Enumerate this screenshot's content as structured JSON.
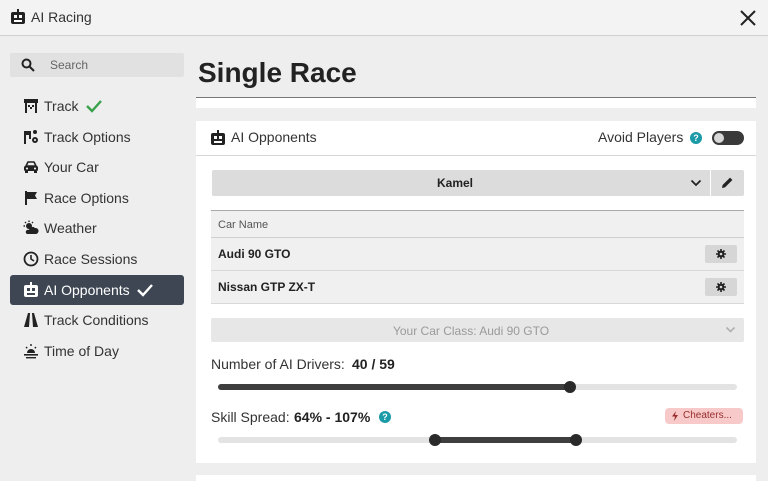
{
  "window": {
    "title": "AI Racing"
  },
  "icons": {
    "app": "robot-icon",
    "close": "close-icon",
    "search": "search-icon",
    "track": "track-flag-icon",
    "track_options": "track-settings-icon",
    "your_car": "car-icon",
    "race_options": "flag-icon",
    "weather": "weather-icon",
    "race_sessions": "clock-icon",
    "ai_opponents": "robot-icon",
    "track_conditions": "road-icon",
    "time_of_day": "sunrise-icon",
    "check": "checkmark-icon",
    "help": "help-icon",
    "edit": "pencil-icon",
    "settings": "gear-icon",
    "cheaters": "lightning-icon"
  },
  "colors": {
    "active_nav": "#3d4652",
    "check_green": "#3aa14b",
    "help_teal": "#1b9aa8",
    "cheaters_bg": "#f7c9c9",
    "cheaters_text": "#9a2d2d"
  },
  "sidebar": {
    "search": {
      "placeholder": "Search",
      "value": ""
    },
    "items": [
      {
        "label": "Track",
        "done": true,
        "active": false
      },
      {
        "label": "Track Options",
        "done": false,
        "active": false
      },
      {
        "label": "Your Car",
        "done": false,
        "active": false
      },
      {
        "label": "Race Options",
        "done": false,
        "active": false
      },
      {
        "label": "Weather",
        "done": false,
        "active": false
      },
      {
        "label": "Race Sessions",
        "done": false,
        "active": false
      },
      {
        "label": "AI Opponents",
        "done": true,
        "active": true
      },
      {
        "label": "Track Conditions",
        "done": false,
        "active": false
      },
      {
        "label": "Time of Day",
        "done": false,
        "active": false
      }
    ]
  },
  "main": {
    "title": "Single Race",
    "ai_card": {
      "title": "AI Opponents",
      "avoid_players_label": "Avoid Players",
      "help_glyph": "?",
      "avoid_players_on": false,
      "preset": "Kamel",
      "table": {
        "header": "Car Name",
        "rows": [
          {
            "name": "Audi 90 GTO"
          },
          {
            "name": "Nissan GTP ZX-T"
          }
        ]
      },
      "car_class": "Your Car Class: Audi 90 GTO",
      "drivers": {
        "label": "Number of AI Drivers:",
        "value_text": "40 / 59",
        "current": 40,
        "max": 59
      },
      "skill": {
        "label": "Skill Spread:",
        "value_text": "64% - 107%",
        "min_pct": 64,
        "max_pct": 107
      },
      "cheaters_label": "Cheaters..."
    }
  }
}
